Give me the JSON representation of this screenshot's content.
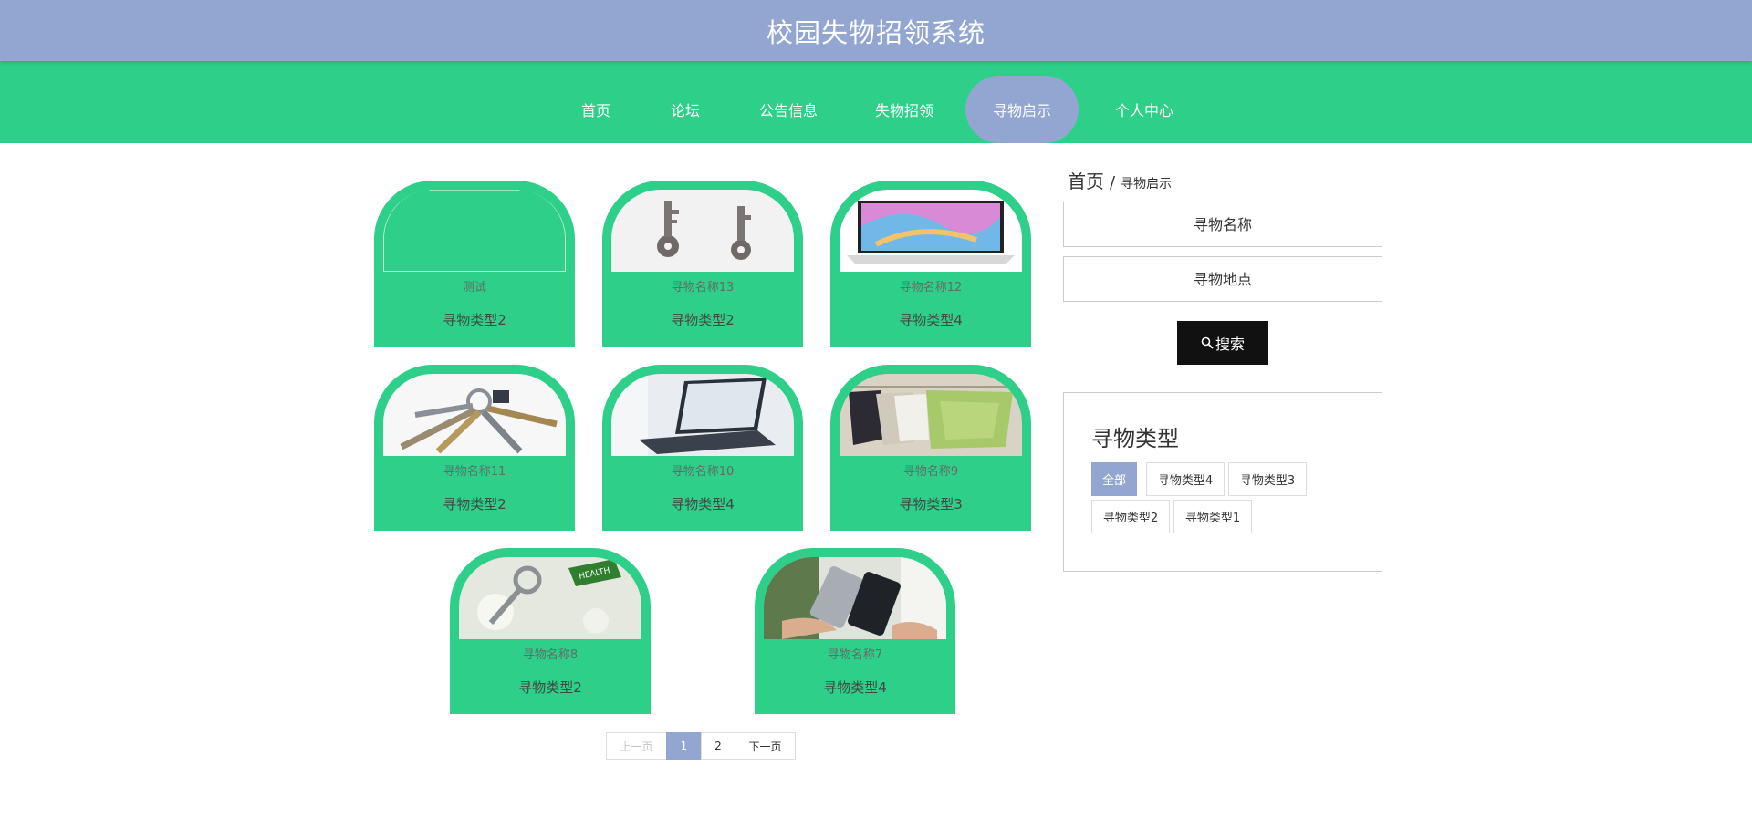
{
  "header": {
    "title": "校园失物招领系统"
  },
  "nav": {
    "items": [
      {
        "label": "首页"
      },
      {
        "label": "论坛"
      },
      {
        "label": "公告信息"
      },
      {
        "label": "失物招领"
      },
      {
        "label": "寻物启示",
        "active": true
      },
      {
        "label": "个人中心"
      }
    ],
    "active_color": "#93a6d1",
    "bar_color": "#2dcf89"
  },
  "cards": [
    {
      "name": "测试",
      "type": "寻物类型2",
      "image": "blank-image"
    },
    {
      "name": "寻物名称13",
      "type": "寻物类型2",
      "image": "keys-photo"
    },
    {
      "name": "寻物名称12",
      "type": "寻物类型4",
      "image": "laptop-photo"
    },
    {
      "name": "寻物名称11",
      "type": "寻物类型2",
      "image": "key-bunch-photo"
    },
    {
      "name": "寻物名称10",
      "type": "寻物类型4",
      "image": "laptop-photo"
    },
    {
      "name": "寻物名称9",
      "type": "寻物类型3",
      "image": "clothes-photo"
    },
    {
      "name": "寻物名称8",
      "type": "寻物类型2",
      "image": "key-photo"
    },
    {
      "name": "寻物名称7",
      "type": "寻物类型4",
      "image": "phone-photo"
    }
  ],
  "pagination": {
    "prev": "上一页",
    "pages": [
      "1",
      "2"
    ],
    "current": "1",
    "next": "下一页"
  },
  "breadcrumb": {
    "home": "首页",
    "separator": "/",
    "current": "寻物启示"
  },
  "search": {
    "name_placeholder": "寻物名称",
    "location_placeholder": "寻物地点",
    "button_label": "搜索"
  },
  "types": {
    "title": "寻物类型",
    "tags": [
      {
        "label": "全部",
        "active": true
      },
      {
        "label": "寻物类型4"
      },
      {
        "label": "寻物类型3"
      },
      {
        "label": "寻物类型2"
      },
      {
        "label": "寻物类型1"
      }
    ]
  },
  "colors": {
    "accent": "#93a6d1",
    "green": "#2dcf89",
    "button": "#111111"
  }
}
